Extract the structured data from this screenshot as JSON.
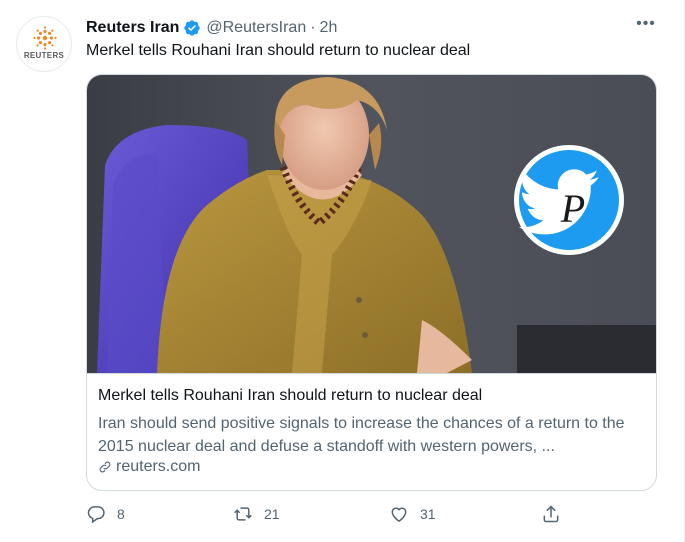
{
  "tweet": {
    "avatar_wordmark": "REUTERS",
    "display_name": "Reuters Iran",
    "handle": "@ReutersIran",
    "separator": "·",
    "timestamp": "2h",
    "text": "Merkel tells Rouhani Iran should return to nuclear deal"
  },
  "card": {
    "title": "Merkel tells Rouhani Iran should return to nuclear deal",
    "description": "Iran should send positive signals to increase the chances of a return to the 2015 nuclear deal and defuse a standoff with western powers, ...",
    "domain": "reuters.com",
    "watermark_letter": "P"
  },
  "actions": {
    "reply_count": "8",
    "retweet_count": "21",
    "like_count": "31"
  },
  "colors": {
    "text_primary": "#0f1419",
    "text_secondary": "#536471",
    "verified_blue": "#1d9bf0",
    "border": "#cfd9de",
    "reuters_orange": "#f08a24"
  },
  "icons": [
    "reuters-logo-icon",
    "verified-badge-icon",
    "more-icon",
    "link-icon",
    "reply-icon",
    "retweet-icon",
    "like-icon",
    "share-icon",
    "twitter-bird-watermark-icon"
  ]
}
